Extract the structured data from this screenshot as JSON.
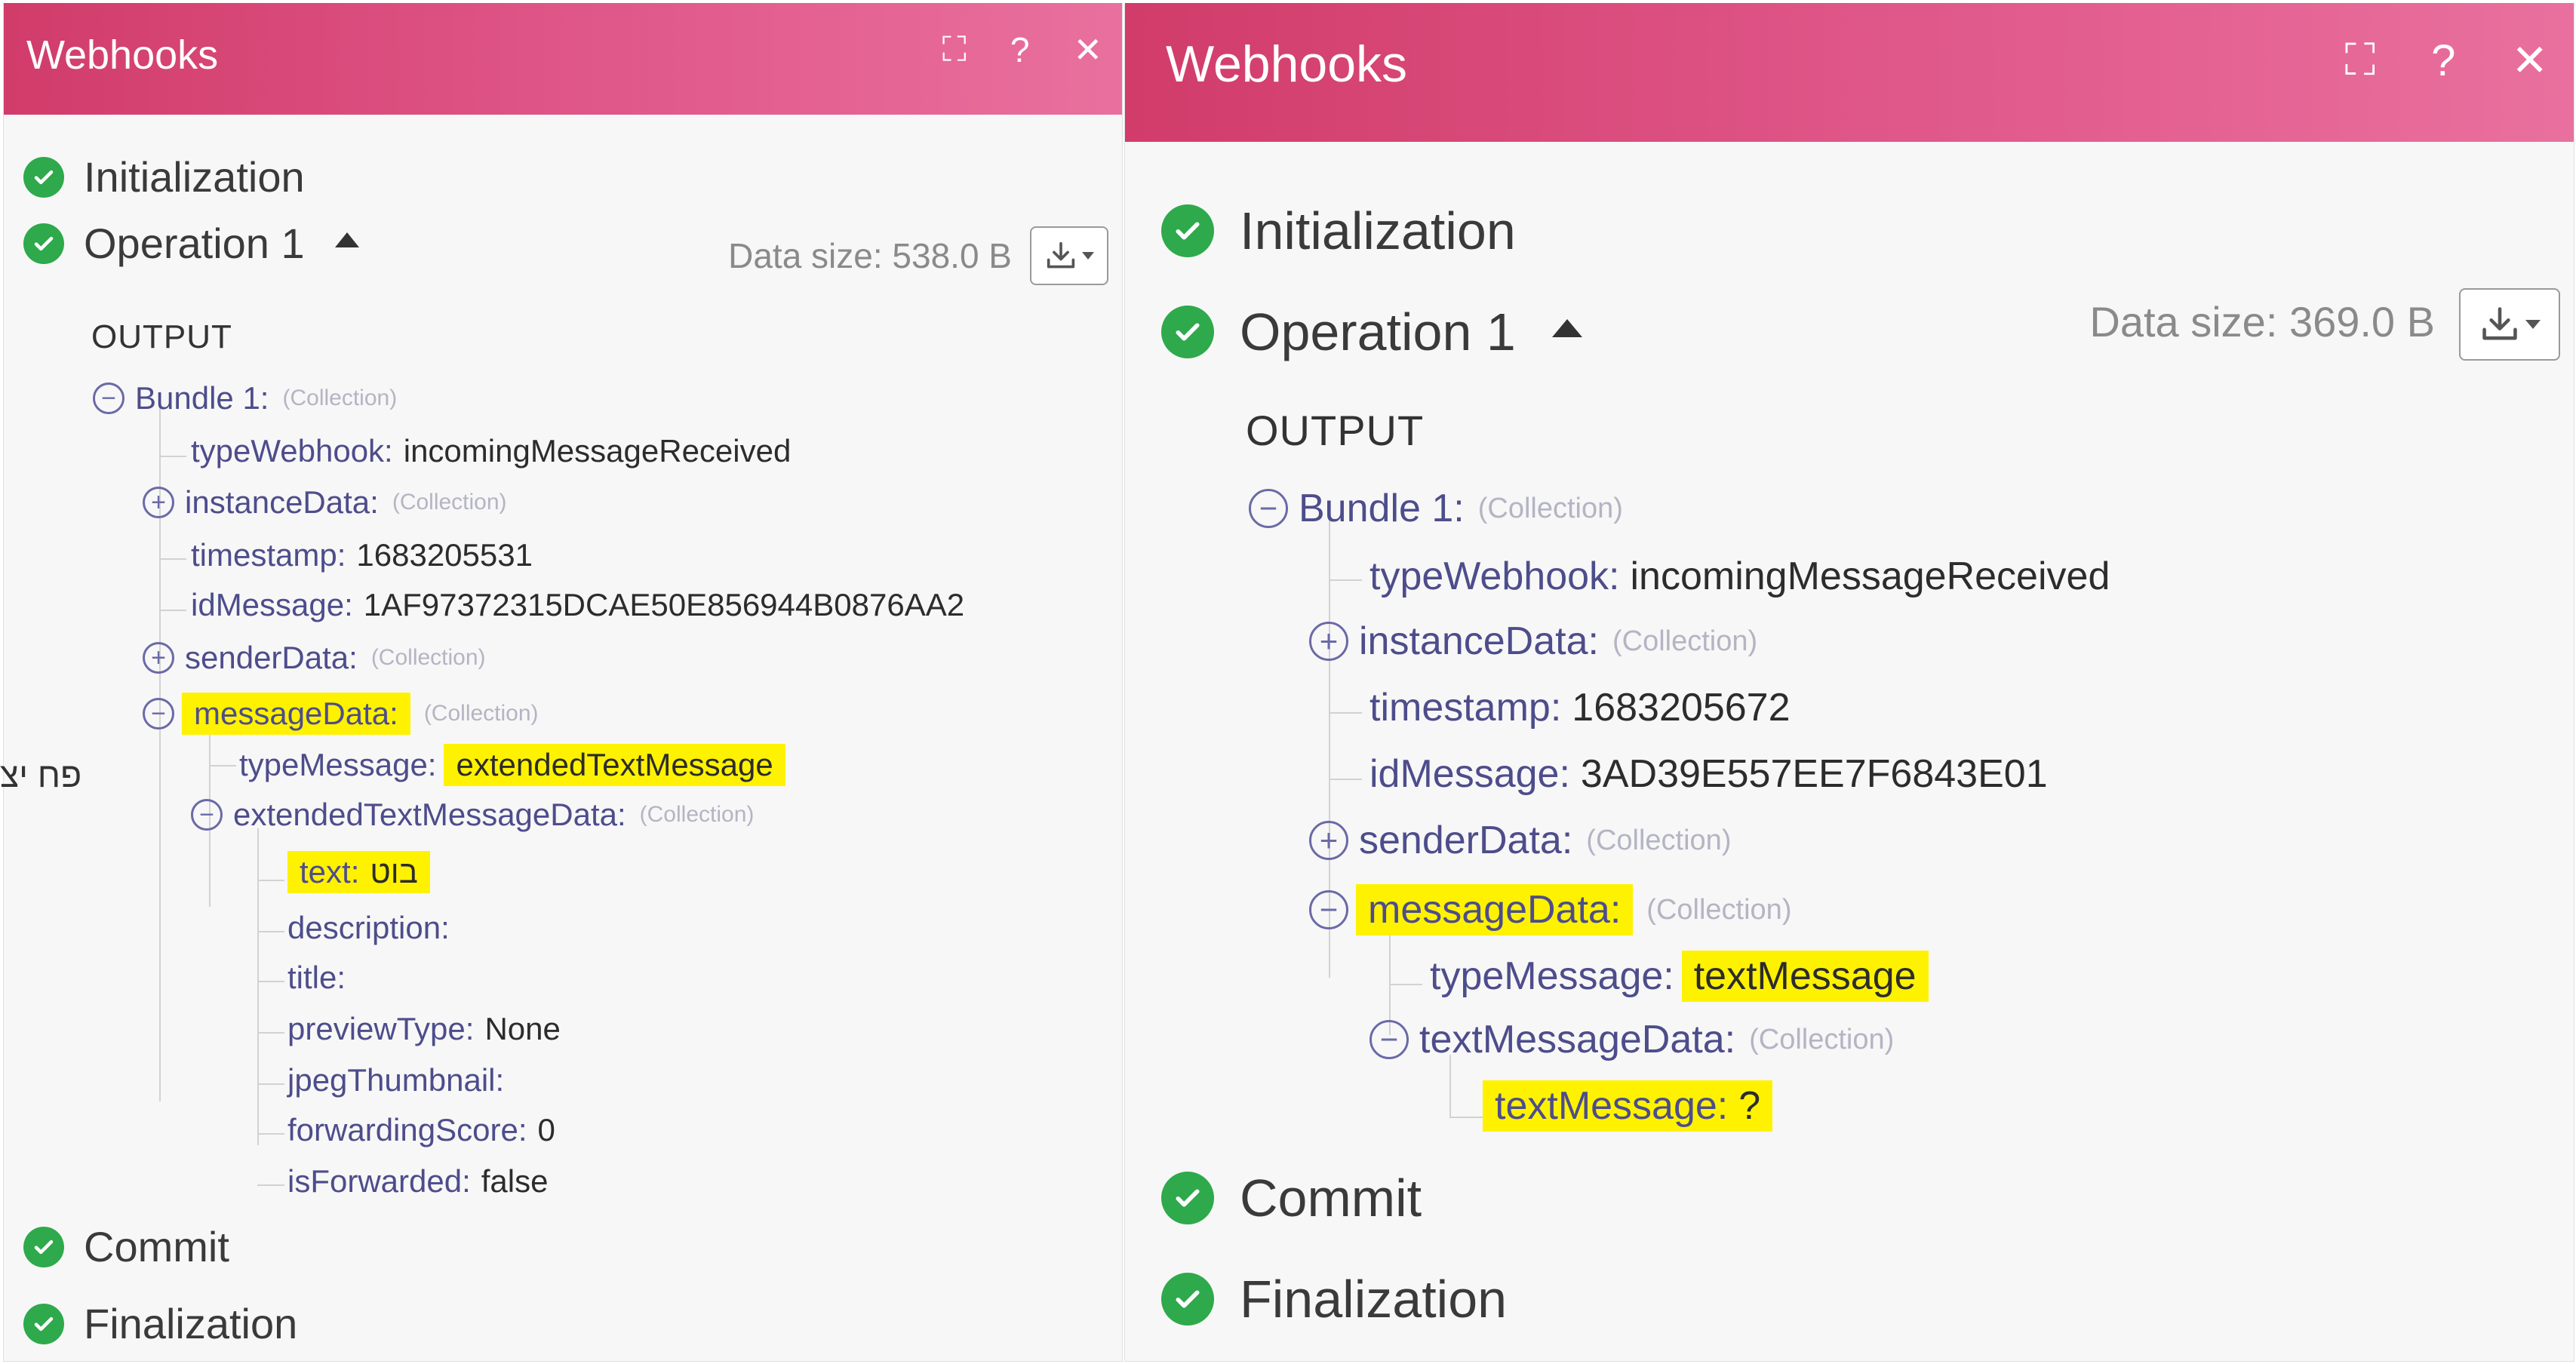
{
  "left": {
    "title": "Webhooks",
    "icons": [
      "expand-icon",
      "help-icon",
      "close-icon"
    ],
    "icon_glyphs": {
      "expand": "⛶",
      "help": "?",
      "close": "✕"
    },
    "phases": {
      "initialization": "Initialization",
      "operation": "Operation 1",
      "commit": "Commit",
      "finalization": "Finalization"
    },
    "data_size": "Data size: 538.0 B",
    "output_label": "OUTPUT",
    "tree": {
      "bundle": "Bundle 1:",
      "collection": "(Collection)",
      "typeWebhook_key": "typeWebhook:",
      "typeWebhook_val": "incomingMessageReceived",
      "instanceData_key": "instanceData:",
      "timestamp_key": "timestamp:",
      "timestamp_val": "1683205531",
      "idMessage_key": "idMessage:",
      "idMessage_val": "1AF97372315DCAE50E856944B0876AA2",
      "senderData_key": "senderData:",
      "messageData_key": "messageData:",
      "typeMessage_key": "typeMessage:",
      "typeMessage_val": "extendedTextMessage",
      "extData_key": "extendedTextMessageData:",
      "text_key": "text:",
      "text_val": "בוט",
      "description_key": "description:",
      "title_key": "title:",
      "previewType_key": "previewType:",
      "previewType_val": "None",
      "jpegThumbnail_key": "jpegThumbnail:",
      "forwardingScore_key": "forwardingScore:",
      "forwardingScore_val": "0",
      "isForwarded_key": "isForwarded:",
      "isForwarded_val": "false"
    },
    "rtl_fragment": "פח יצ"
  },
  "right": {
    "title": "Webhooks",
    "icons": [
      "expand-icon",
      "help-icon",
      "close-icon"
    ],
    "icon_glyphs": {
      "expand": "⛶",
      "help": "?",
      "close": "✕"
    },
    "phases": {
      "initialization": "Initialization",
      "operation": "Operation 1",
      "commit": "Commit",
      "finalization": "Finalization"
    },
    "data_size": "Data size: 369.0 B",
    "output_label": "OUTPUT",
    "tree": {
      "bundle": "Bundle 1:",
      "collection": "(Collection)",
      "typeWebhook_key": "typeWebhook:",
      "typeWebhook_val": "incomingMessageReceived",
      "instanceData_key": "instanceData:",
      "timestamp_key": "timestamp:",
      "timestamp_val": "1683205672",
      "idMessage_key": "idMessage:",
      "idMessage_val": "3AD39E557EE7F6843E01",
      "senderData_key": "senderData:",
      "messageData_key": "messageData:",
      "typeMessage_key": "typeMessage:",
      "typeMessage_val": "textMessage",
      "textMsgData_key": "textMessageData:",
      "textMessage_key": "textMessage:",
      "textMessage_val": "?"
    }
  },
  "colors": {
    "header_start": "#d13c6a",
    "header_end": "#e9709e",
    "success": "#2ea94b",
    "highlight": "#fff200",
    "key_text": "#4d4d8c"
  }
}
